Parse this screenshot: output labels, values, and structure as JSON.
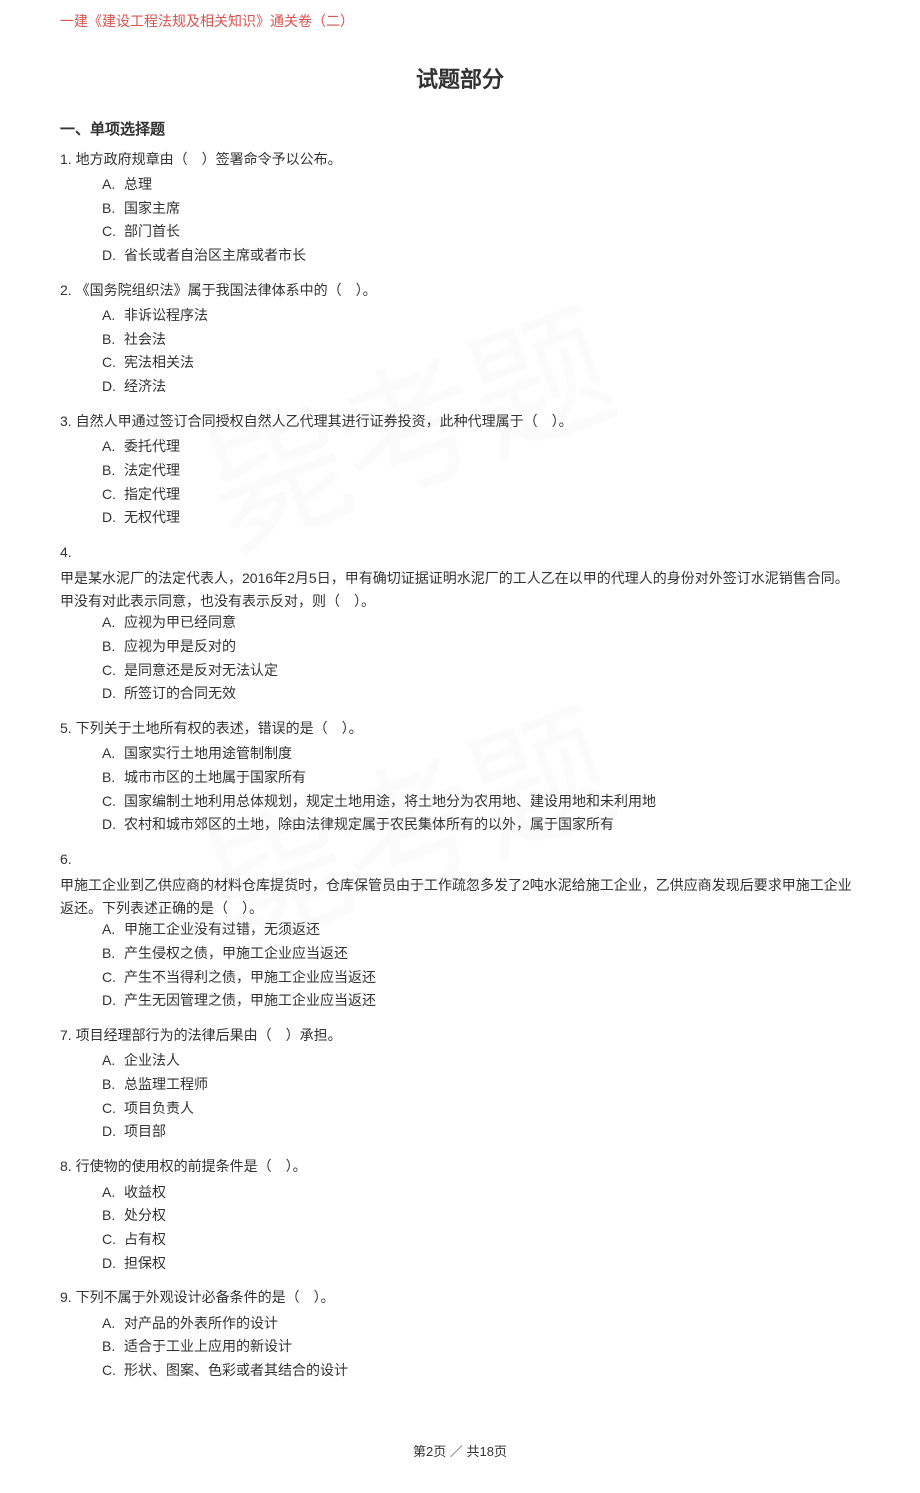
{
  "header": "一建《建设工程法规及相关知识》通关卷（二）",
  "main_title": "试题部分",
  "section_title": "一、单项选择题",
  "questions": [
    {
      "num": "1.",
      "stem": "地方政府规章由（　）签署命令予以公布。",
      "options": [
        {
          "letter": "A.",
          "text": "总理"
        },
        {
          "letter": "B.",
          "text": "国家主席"
        },
        {
          "letter": "C.",
          "text": "部门首长"
        },
        {
          "letter": "D.",
          "text": "省长或者自治区主席或者市长"
        }
      ]
    },
    {
      "num": "2.",
      "stem": "《国务院组织法》属于我国法律体系中的（　）。",
      "options": [
        {
          "letter": "A.",
          "text": "非诉讼程序法"
        },
        {
          "letter": "B.",
          "text": "社会法"
        },
        {
          "letter": "C.",
          "text": "宪法相关法"
        },
        {
          "letter": "D.",
          "text": "经济法"
        }
      ]
    },
    {
      "num": "3.",
      "stem": "自然人甲通过签订合同授权自然人乙代理其进行证券投资，此种代理属于（　）。",
      "options": [
        {
          "letter": "A.",
          "text": "委托代理"
        },
        {
          "letter": "B.",
          "text": "法定代理"
        },
        {
          "letter": "C.",
          "text": "指定代理"
        },
        {
          "letter": "D.",
          "text": "无权代理"
        }
      ]
    },
    {
      "num": "4.",
      "stem": "",
      "body": "甲是某水泥厂的法定代表人，2016年2月5日，甲有确切证据证明水泥厂的工人乙在以甲的代理人的身份对外签订水泥销售合同。甲没有对此表示同意，也没有表示反对，则（　）。",
      "options": [
        {
          "letter": "A.",
          "text": "应视为甲已经同意"
        },
        {
          "letter": "B.",
          "text": "应视为甲是反对的"
        },
        {
          "letter": "C.",
          "text": "是同意还是反对无法认定"
        },
        {
          "letter": "D.",
          "text": "所签订的合同无效"
        }
      ]
    },
    {
      "num": "5.",
      "stem": "下列关于土地所有权的表述，错误的是（　）。",
      "options": [
        {
          "letter": "A.",
          "text": "国家实行土地用途管制制度"
        },
        {
          "letter": "B.",
          "text": "城市市区的土地属于国家所有"
        },
        {
          "letter": "C.",
          "text": "国家编制土地利用总体规划，规定土地用途，将土地分为农用地、建设用地和未利用地"
        },
        {
          "letter": "D.",
          "text": "农村和城市郊区的土地，除由法律规定属于农民集体所有的以外，属于国家所有"
        }
      ]
    },
    {
      "num": "6.",
      "stem": "",
      "body": "甲施工企业到乙供应商的材料仓库提货时，仓库保管员由于工作疏忽多发了2吨水泥给施工企业，乙供应商发现后要求甲施工企业返还。下列表述正确的是（　）。",
      "options": [
        {
          "letter": "A.",
          "text": "甲施工企业没有过错，无须返还"
        },
        {
          "letter": "B.",
          "text": "产生侵权之债，甲施工企业应当返还"
        },
        {
          "letter": "C.",
          "text": "产生不当得利之债，甲施工企业应当返还"
        },
        {
          "letter": "D.",
          "text": "产生无因管理之债，甲施工企业应当返还"
        }
      ]
    },
    {
      "num": "7.",
      "stem": "项目经理部行为的法律后果由（　）承担。",
      "options": [
        {
          "letter": "A.",
          "text": "企业法人"
        },
        {
          "letter": "B.",
          "text": "总监理工程师"
        },
        {
          "letter": "C.",
          "text": "项目负责人"
        },
        {
          "letter": "D.",
          "text": "项目部"
        }
      ]
    },
    {
      "num": "8.",
      "stem": "行使物的使用权的前提条件是（　）。",
      "options": [
        {
          "letter": "A.",
          "text": "收益权"
        },
        {
          "letter": "B.",
          "text": "处分权"
        },
        {
          "letter": "C.",
          "text": "占有权"
        },
        {
          "letter": "D.",
          "text": "担保权"
        }
      ]
    },
    {
      "num": "9.",
      "stem": "下列不属于外观设计必备条件的是（　）。",
      "options": [
        {
          "letter": "A.",
          "text": "对产品的外表所作的设计"
        },
        {
          "letter": "B.",
          "text": "适合于工业上应用的新设计"
        },
        {
          "letter": "C.",
          "text": "形状、图案、色彩或者其结合的设计"
        }
      ]
    }
  ],
  "footer": "第2页 ／ 共18页"
}
